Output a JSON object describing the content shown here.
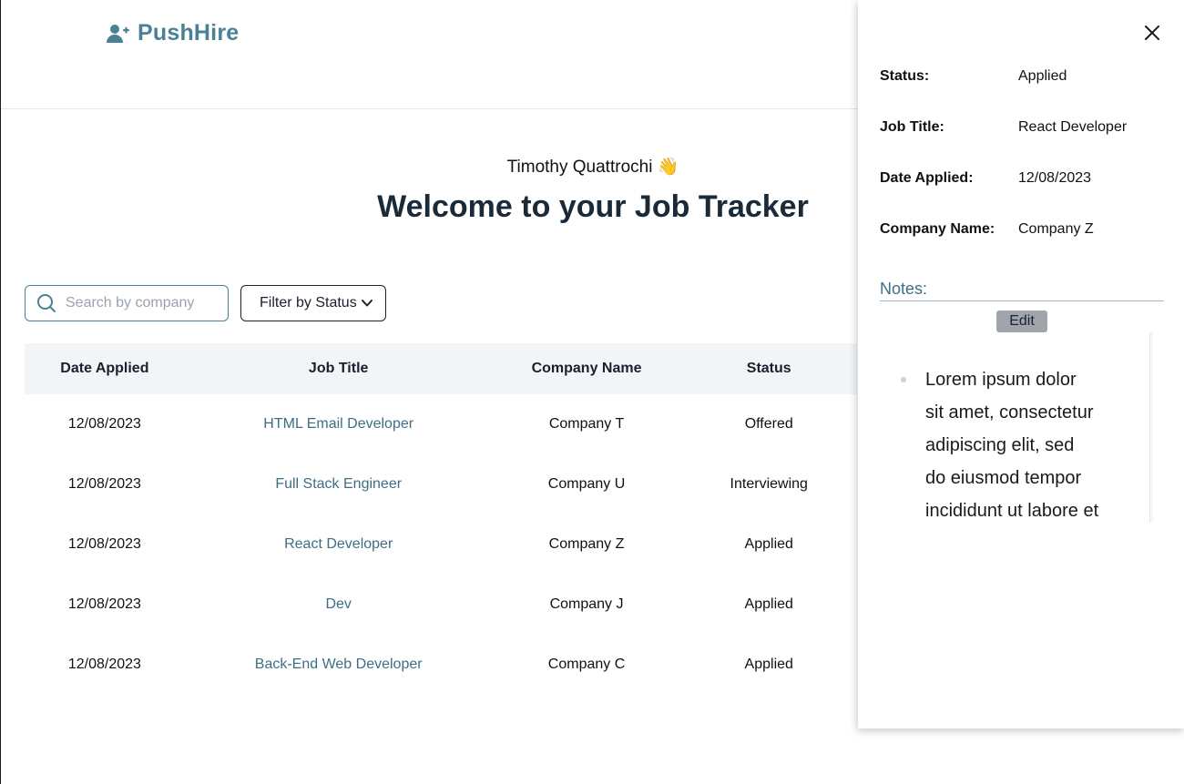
{
  "app": {
    "brand_name": "PushHire",
    "brand_icon": "user-plus-icon",
    "brand_color": "#4a8196"
  },
  "hero": {
    "user_name": "Timothy Quattrochi",
    "wave_emoji": "👋",
    "title": "Welcome to your Job Tracker"
  },
  "controls": {
    "search_placeholder": "Search by company",
    "search_value": "",
    "filter_label": "Filter by Status"
  },
  "table": {
    "headers": {
      "date": "Date Applied",
      "job": "Job Title",
      "company": "Company Name",
      "status": "Status"
    },
    "rows": [
      {
        "date": "12/08/2023",
        "job": "HTML Email Developer",
        "company": "Company T",
        "status": "Offered"
      },
      {
        "date": "12/08/2023",
        "job": "Full Stack Engineer",
        "company": "Company U",
        "status": "Interviewing"
      },
      {
        "date": "12/08/2023",
        "job": "React Developer",
        "company": "Company Z",
        "status": "Applied"
      },
      {
        "date": "12/08/2023",
        "job": "Dev",
        "company": "Company J",
        "status": "Applied"
      },
      {
        "date": "12/08/2023",
        "job": "Back-End Web Developer",
        "company": "Company C",
        "status": "Applied"
      }
    ]
  },
  "drawer": {
    "close_icon": "close-icon",
    "details": {
      "status_label": "Status:",
      "status_value": "Applied",
      "job_label": "Job Title:",
      "job_value": "React Developer",
      "date_label": "Date Applied:",
      "date_value": "12/08/2023",
      "company_label": "Company Name:",
      "company_value": "Company Z"
    },
    "notes_label": "Notes:",
    "edit_label": "Edit",
    "notes": [
      "Lorem ipsum dolor sit amet, consectetur adipiscing elit, sed do eiusmod tempor incididunt ut labore et"
    ]
  }
}
